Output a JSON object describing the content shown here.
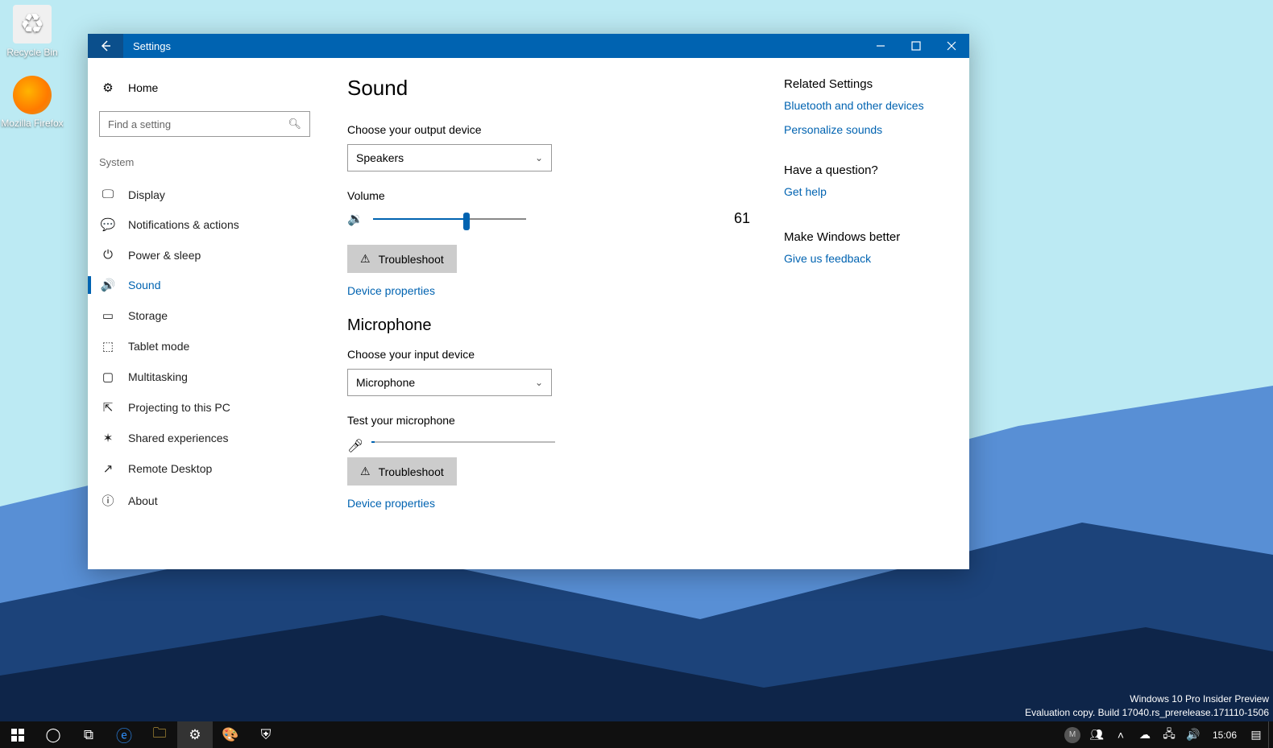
{
  "desktop": {
    "icons": {
      "recycle_bin": "Recycle Bin",
      "firefox": "Mozilla Firefox"
    },
    "watermark_line1": "Windows 10 Pro Insider Preview",
    "watermark_line2": "Evaluation copy. Build 17040.rs_prerelease.171110-1506"
  },
  "taskbar": {
    "clock": "15:06",
    "avatar_letter": "M"
  },
  "window": {
    "title": "Settings",
    "sidebar": {
      "home": "Home",
      "search_placeholder": "Find a setting",
      "section": "System",
      "items": [
        {
          "label": "Display"
        },
        {
          "label": "Notifications & actions"
        },
        {
          "label": "Power & sleep"
        },
        {
          "label": "Sound"
        },
        {
          "label": "Storage"
        },
        {
          "label": "Tablet mode"
        },
        {
          "label": "Multitasking"
        },
        {
          "label": "Projecting to this PC"
        },
        {
          "label": "Shared experiences"
        },
        {
          "label": "Remote Desktop"
        },
        {
          "label": "About"
        }
      ]
    },
    "main": {
      "page_title": "Sound",
      "output_label": "Choose your output device",
      "output_value": "Speakers",
      "volume_label": "Volume",
      "volume_value": "61",
      "volume_percent": 61,
      "troubleshoot_label": "Troubleshoot",
      "device_properties_link": "Device properties",
      "mic_heading": "Microphone",
      "input_label": "Choose your input device",
      "input_value": "Microphone",
      "mic_test_label": "Test your microphone"
    },
    "aside": {
      "related_heading": "Related Settings",
      "related_links": {
        "bt": "Bluetooth and other devices",
        "sounds": "Personalize sounds"
      },
      "question_heading": "Have a question?",
      "help_link": "Get help",
      "better_heading": "Make Windows better",
      "feedback_link": "Give us feedback"
    }
  }
}
